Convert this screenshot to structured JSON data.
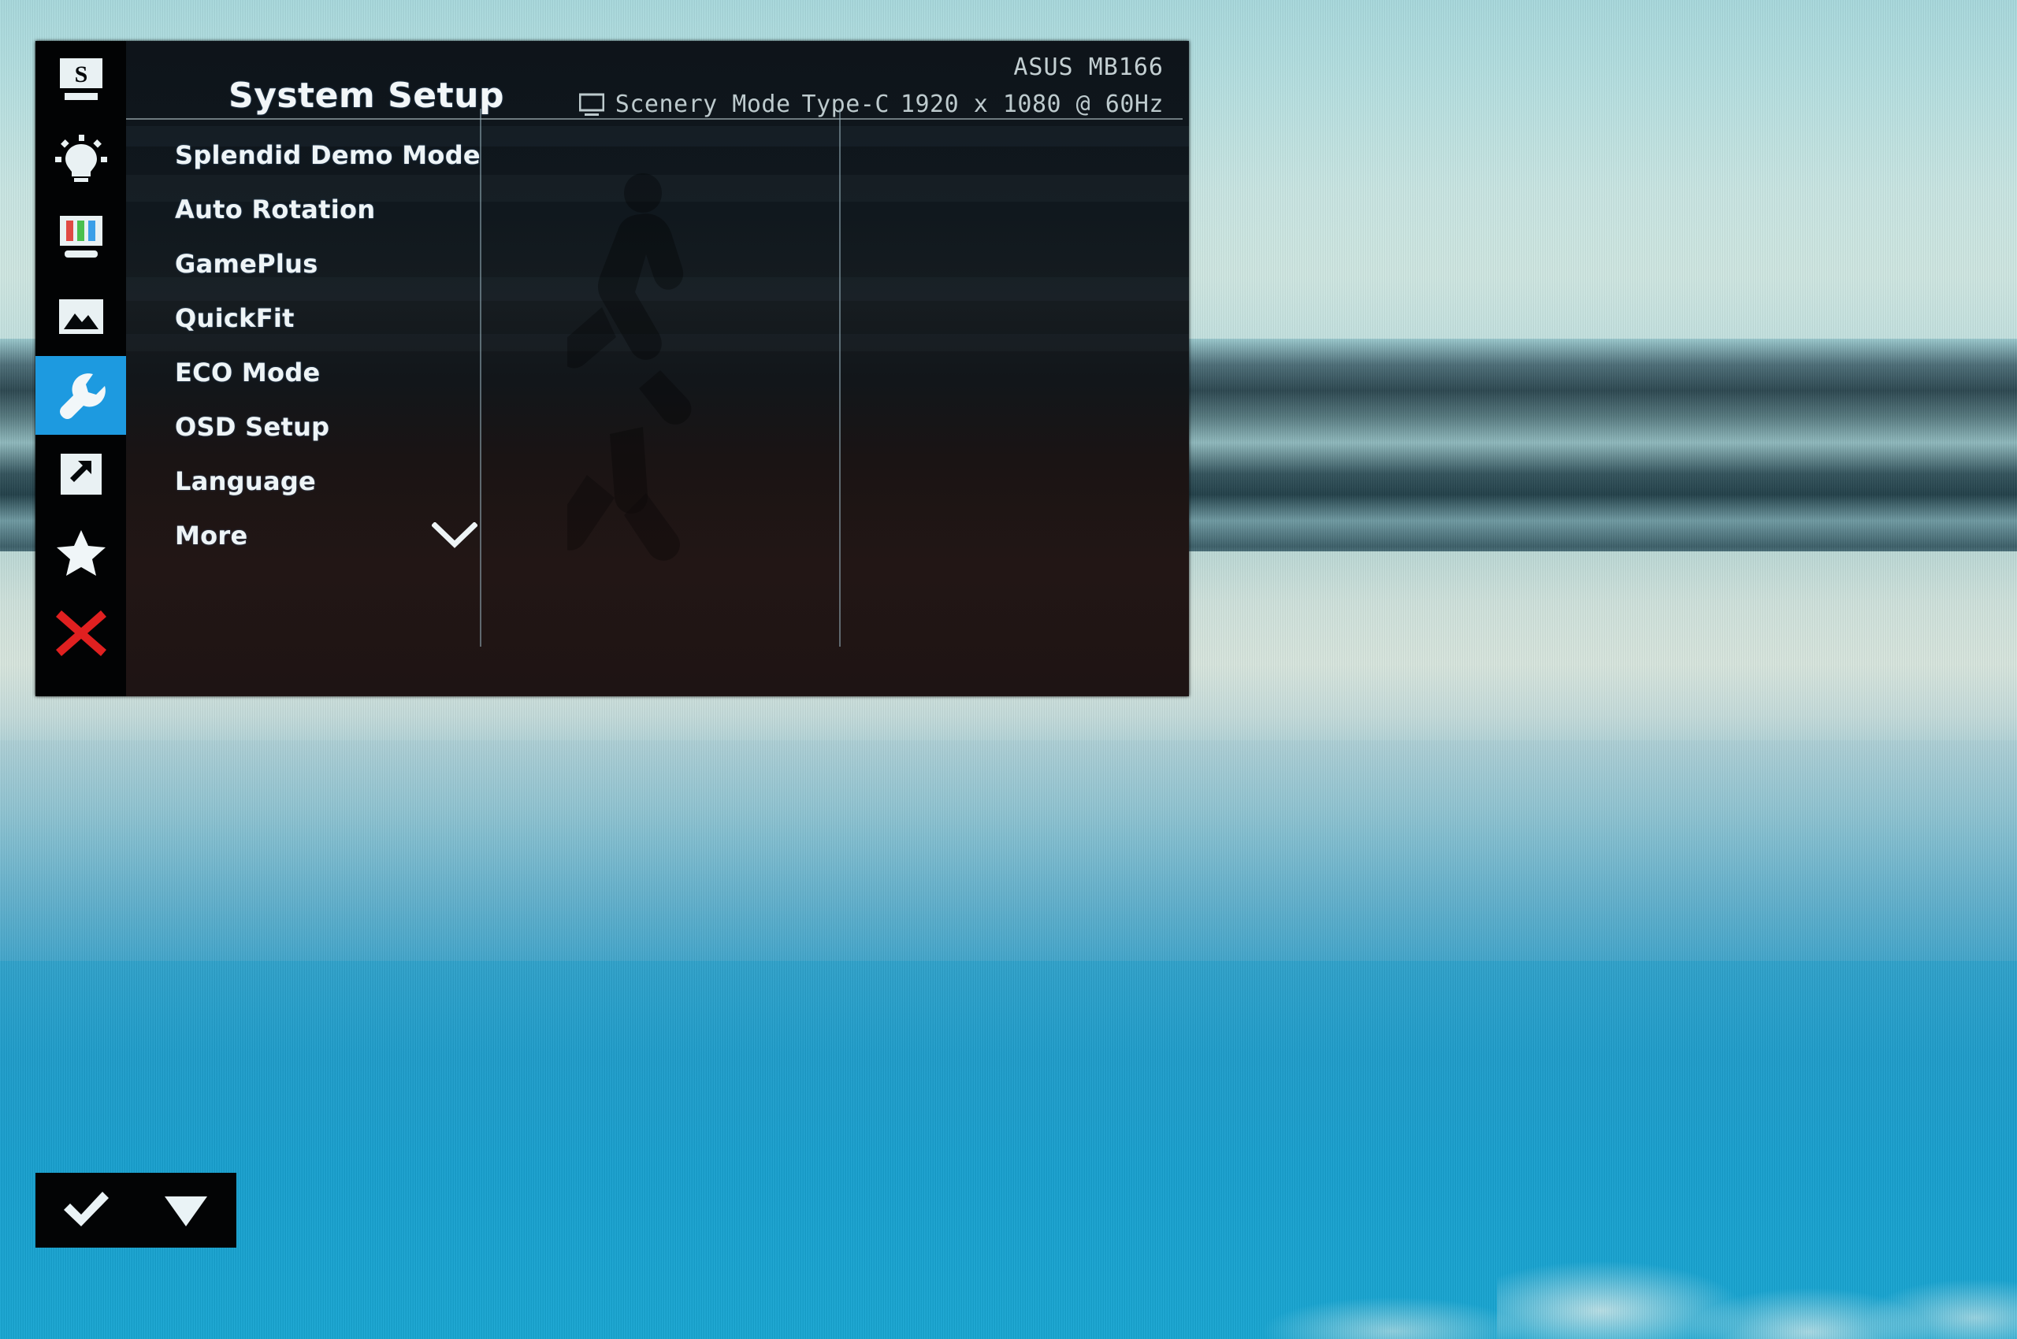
{
  "device": {
    "brand_model": "ASUS MB166"
  },
  "osd": {
    "title": "System Setup",
    "status": {
      "display_icon": "monitor-icon",
      "picture_mode": "Scenery Mode",
      "input_source": "Type-C",
      "resolution": "1920 x 1080 @ 60Hz",
      "model": "ASUS MB166"
    },
    "sidebar": {
      "items": [
        {
          "id": "splendid",
          "label": "Splendid",
          "icon": "splendid-monitor-s-icon",
          "active": false
        },
        {
          "id": "blue-light",
          "label": "Blue Light Filter",
          "icon": "lightbulb-icon",
          "active": false
        },
        {
          "id": "color",
          "label": "Color",
          "icon": "color-bars-icon",
          "active": false
        },
        {
          "id": "image",
          "label": "Image",
          "icon": "picture-mountain-icon",
          "active": false
        },
        {
          "id": "system-setup",
          "label": "System Setup",
          "icon": "wrench-icon",
          "active": true
        },
        {
          "id": "input-select",
          "label": "Input Select",
          "icon": "arrow-in-box-icon",
          "active": false
        },
        {
          "id": "shortcut",
          "label": "Shortcut",
          "icon": "star-icon",
          "active": false
        },
        {
          "id": "exit",
          "label": "Exit",
          "icon": "close-x-icon",
          "active": false
        }
      ]
    },
    "menu": {
      "items": [
        {
          "label": "Splendid Demo Mode",
          "has_submenu": false
        },
        {
          "label": "Auto Rotation",
          "has_submenu": false
        },
        {
          "label": "GamePlus",
          "has_submenu": false
        },
        {
          "label": "QuickFit",
          "has_submenu": false
        },
        {
          "label": "ECO Mode",
          "has_submenu": false
        },
        {
          "label": "OSD Setup",
          "has_submenu": false
        },
        {
          "label": "Language",
          "has_submenu": false
        },
        {
          "label": "More",
          "has_submenu": true,
          "submenu_icon": "chevron-down-icon"
        }
      ]
    }
  },
  "control_bar": {
    "buttons": [
      {
        "id": "confirm",
        "icon": "check-icon",
        "label": "Confirm"
      },
      {
        "id": "next",
        "icon": "triangle-down-icon",
        "label": "Next"
      }
    ]
  },
  "colors": {
    "accent_highlight": "#1d9ae0",
    "exit_red": "#e02020",
    "osd_background": "#050607",
    "text_primary": "#eef4f6",
    "text_secondary": "#bdcacd",
    "desktop_water": "#17a0cf",
    "desktop_sky": "#c2e3e2"
  }
}
